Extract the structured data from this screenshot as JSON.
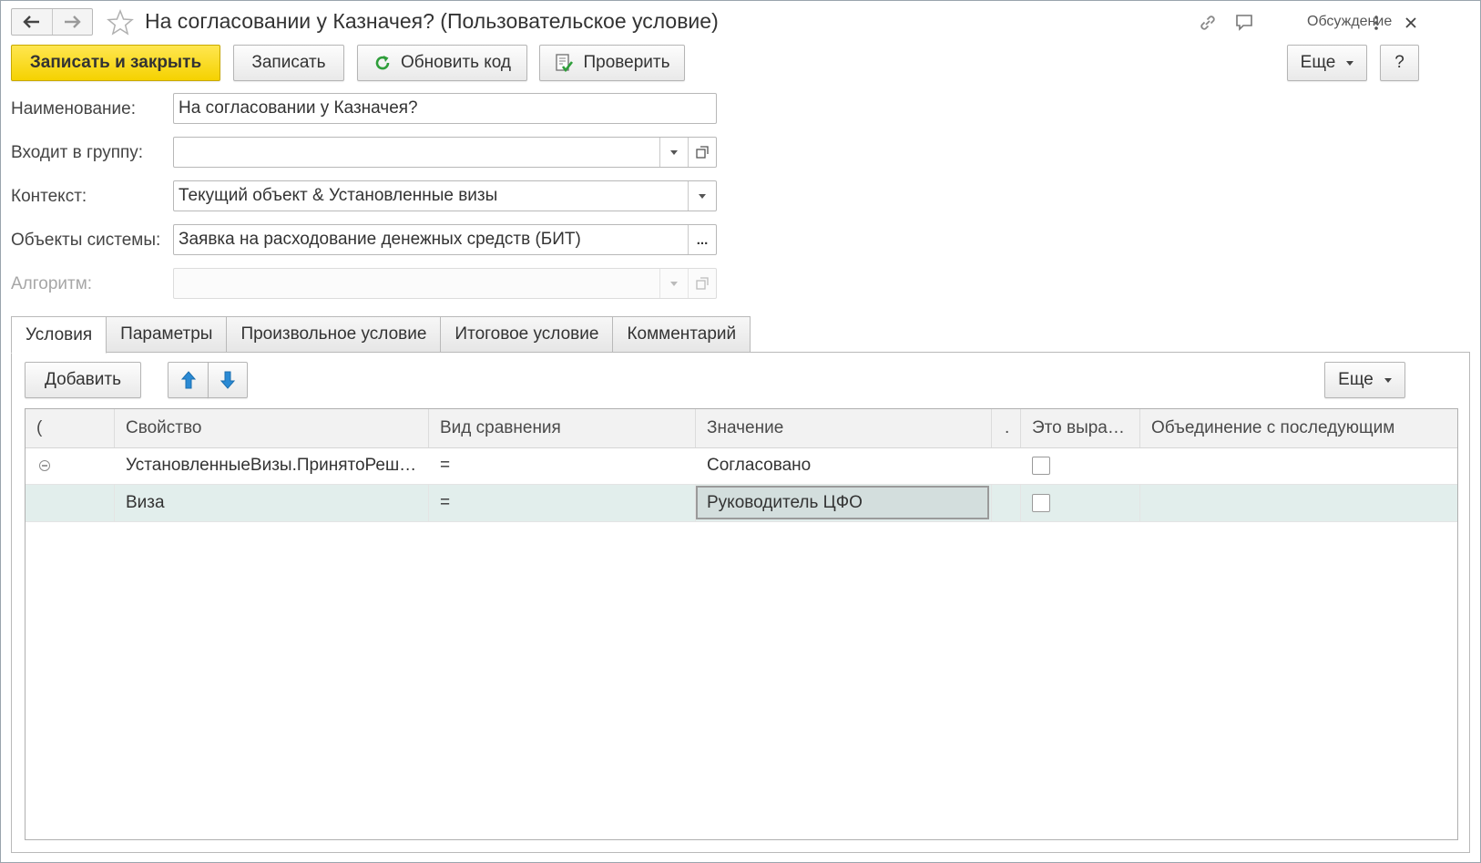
{
  "window": {
    "title": "На согласовании у Казначея? (Пользовательское условие)",
    "discussion_label": "Обсуждение"
  },
  "toolbar": {
    "save_close_label": "Записать и закрыть",
    "save_label": "Записать",
    "refresh_code_label": "Обновить код",
    "check_label": "Проверить",
    "more_label": "Еще",
    "help_label": "?"
  },
  "form": {
    "name_label": "Наименование:",
    "name_value": "На согласовании у Казначея?",
    "group_label": "Входит в группу:",
    "group_value": "",
    "context_label": "Контекст:",
    "context_value": "Текущий объект & Установленные визы",
    "objects_label": "Объекты системы:",
    "objects_value": "Заявка на расходование денежных средств (БИТ)",
    "objects_button": "...",
    "algorithm_label": "Алгоритм:",
    "algorithm_value": ""
  },
  "tabs": [
    "Условия",
    "Параметры",
    "Произвольное условие",
    "Итоговое условие",
    "Комментарий"
  ],
  "conditions": {
    "add_label": "Добавить",
    "more_label": "Еще",
    "columns": [
      "(",
      "Свойство",
      "Вид сравнения",
      "Значение",
      ".",
      "Это выра…",
      "Объединение с последующим"
    ],
    "rows": [
      {
        "property": "УстановленныеВизы.ПринятоРеш…",
        "comparison": "=",
        "value": "Согласовано",
        "is_expression": false,
        "union": ""
      },
      {
        "property": "Виза",
        "comparison": "=",
        "value": "Руководитель ЦФО",
        "is_expression": false,
        "union": ""
      }
    ]
  },
  "colors": {
    "primary_button": "#f5d200",
    "selected_row": "#e2eeec",
    "arrow_blue": "#2a8ad4",
    "refresh_green": "#2e9e3a"
  }
}
